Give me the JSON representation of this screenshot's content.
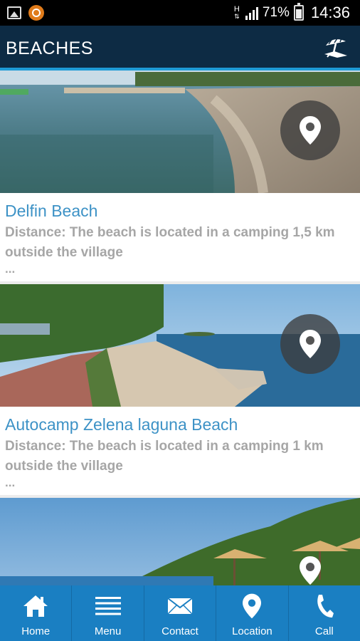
{
  "status_bar": {
    "network": "H",
    "battery": "71%",
    "time": "14:36"
  },
  "header": {
    "title": "BEACHES",
    "icon": "beach-umbrella-icon"
  },
  "beaches": [
    {
      "title": "Delfin Beach",
      "description": "Distance: The beach is located in a camping 1,5 km outside the village",
      "more": "..."
    },
    {
      "title": "Autocamp Zelena laguna Beach",
      "description": "Distance: The beach is located in a camping 1 km outside the village",
      "more": "..."
    },
    {
      "title": "",
      "description": "",
      "more": ""
    }
  ],
  "nav": [
    {
      "label": "Home",
      "icon": "home-icon"
    },
    {
      "label": "Menu",
      "icon": "menu-icon"
    },
    {
      "label": "Contact",
      "icon": "envelope-icon"
    },
    {
      "label": "Location",
      "icon": "location-pin-icon"
    },
    {
      "label": "Call",
      "icon": "phone-icon"
    }
  ],
  "colors": {
    "header_bg": "#0d2b44",
    "header_accent": "#1e9bd6",
    "title_blue": "#3d92c6",
    "nav_bg": "#1a7fc2"
  }
}
